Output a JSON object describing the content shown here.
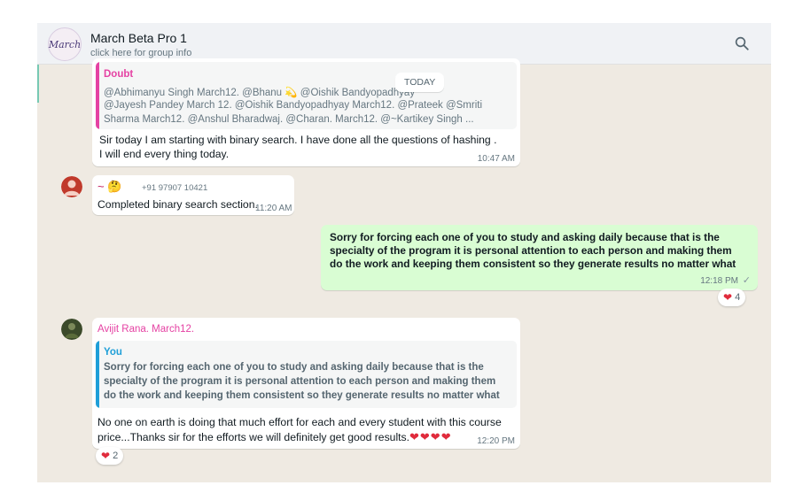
{
  "header": {
    "avatar_text": "March",
    "title": "March Beta Pro 1",
    "subtitle": "click here for group info",
    "search_icon": "search-icon"
  },
  "date_chip": "TODAY",
  "msg1": {
    "quote_name": "Doubt",
    "quote_name_color": "#e542a3",
    "quote_lines": [
      "@Abhimanyu Singh March12. @Bhanu 💫 @Oishik Bandyopadhyay",
      "@Jayesh Pandey March 12. @Oishik Bandyopadhyay March12. @Prateek @Smriti",
      "Sharma March12. @Anshul Bharadwaj. @Charan. March12. @~Kartikey Singh ..."
    ],
    "lines": [
      "Sir today I am starting with binary search. I have done all the questions of hashing .",
      "I will end every thing today."
    ],
    "time": "10:47 AM"
  },
  "msg2": {
    "sender": "~ 🤔",
    "phone": "+91 97907 10421",
    "text": "Completed binary search section.",
    "time": "11:20 AM"
  },
  "msg3": {
    "lines": [
      "Sorry for forcing each one of you to study and asking daily because that is the",
      "specialty of the program it is personal attention to each person and making them",
      "do the work and keeping them consistent so they generate results no matter what"
    ],
    "time": "12:18 PM",
    "tick": "✓",
    "reaction_emoji": "❤",
    "reaction_count": "4"
  },
  "msg4": {
    "sender": "Avijit Rana. March12.",
    "sender_color": "#e542a3",
    "quote_name": "You",
    "quote_name_color": "#1f9fd8",
    "quote_lines": [
      "Sorry for forcing each one of you to study and asking daily because that is the",
      "specialty of the program it is personal attention to each person and making them",
      "do the work and keeping them consistent so they generate results no matter what"
    ],
    "lines": [
      "No one on earth is doing that much effort for each and every student with this course",
      "price...Thanks sir for the efforts we will definitely get good results."
    ],
    "hearts": "❤❤❤❤",
    "time": "12:20 PM",
    "reaction_emoji": "❤",
    "reaction_count": "2"
  }
}
